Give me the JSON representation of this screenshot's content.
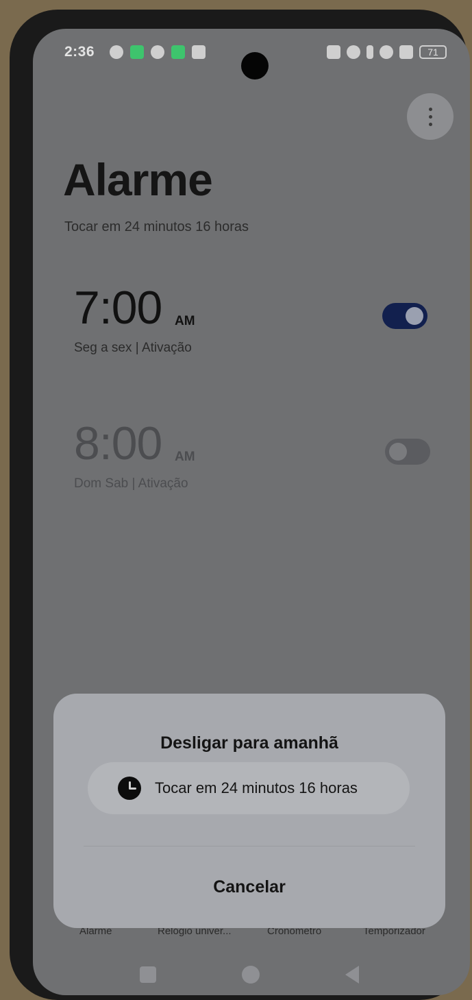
{
  "status_bar": {
    "time": "2:36",
    "battery": "71"
  },
  "header": {
    "title": "Alarme",
    "subtitle": "Tocar em 24 minutos 16 horas"
  },
  "alarms": [
    {
      "time": "7:00",
      "ampm": "AM",
      "days": "Seg  a sex  | Ativação",
      "enabled": true
    },
    {
      "time": "8:00",
      "ampm": "AM",
      "days": "Dom Sab | Ativação",
      "enabled": false
    }
  ],
  "dialog": {
    "title": "Desligar para amanhã",
    "option_text": "Tocar em 24 minutos 16 horas",
    "cancel_label": "Cancelar"
  },
  "tabs": [
    "Alarme",
    "Relógio univer...",
    "Cronômetro",
    "Temporizador"
  ],
  "colors": {
    "toggle_on": "#12204e",
    "screen_dim": "#6f7072",
    "dialog_bg": "#a7a9ae"
  }
}
